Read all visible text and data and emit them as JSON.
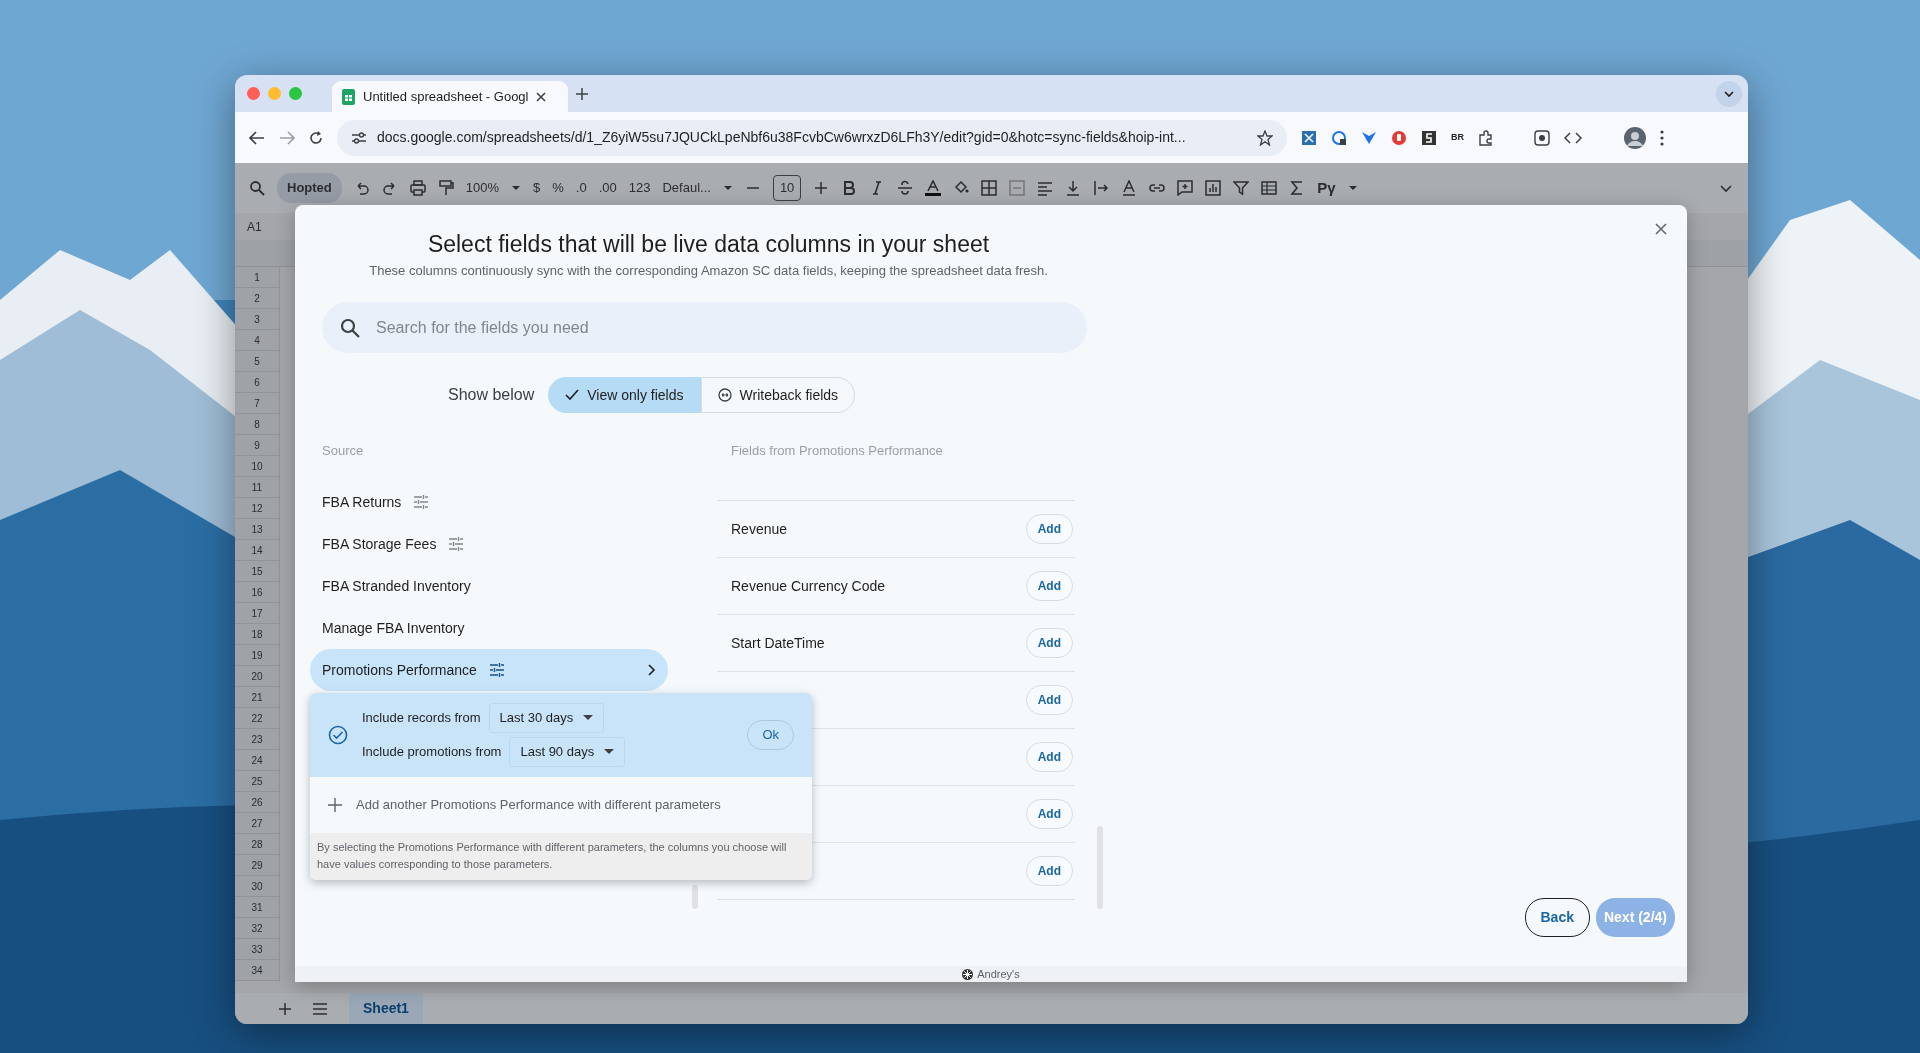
{
  "browser": {
    "tab_title": "Untitled spreadsheet - Googl",
    "url": "docs.google.com/spreadsheets/d/1_Z6yiW5su7JQUCkLpeNbf6u38FcvbCw6wrxzD6LFh3Y/edit?gid=0&hotc=sync-fields&hoip-int...",
    "extension_label": "BR"
  },
  "sheet_toolbar": {
    "menu_label": "Hopted",
    "zoom": "100%",
    "currency": "$",
    "percent": "%",
    "decrease_decimals": ".0",
    "increase_decimals": ".00",
    "number_format": "123",
    "font": "Defaul...",
    "font_size": "10",
    "extension": "Pγ"
  },
  "sheet": {
    "name_box": "A1",
    "row_numbers": [
      "1",
      "2",
      "3",
      "4",
      "5",
      "6",
      "7",
      "8",
      "9",
      "10",
      "11",
      "12",
      "13",
      "14",
      "15",
      "16",
      "17",
      "18",
      "19",
      "20",
      "21",
      "22",
      "23",
      "24",
      "25",
      "26",
      "27",
      "28",
      "29",
      "30",
      "31",
      "32",
      "33",
      "34"
    ],
    "sheet_tab": "Sheet1"
  },
  "dialog": {
    "title": "Select fields that will be live data columns in your sheet",
    "subtitle": "These columns continuously sync with the corresponding Amazon SC data fields, keeping the spreadsheet data fresh.",
    "search": {
      "placeholder": "Search for the fields you need"
    },
    "show_below_label": "Show below",
    "toggle": [
      {
        "label": "View only fields",
        "selected": true
      },
      {
        "label": "Writeback fields",
        "selected": false
      }
    ],
    "source_header": "Source",
    "sources": [
      {
        "name": "FBA Returns",
        "has_params": true,
        "selected": false
      },
      {
        "name": "FBA Storage Fees",
        "has_params": true,
        "selected": false
      },
      {
        "name": "FBA Stranded Inventory",
        "has_params": false,
        "selected": false
      },
      {
        "name": "Manage FBA Inventory",
        "has_params": false,
        "selected": false
      },
      {
        "name": "Promotions Performance",
        "has_params": true,
        "selected": true
      }
    ],
    "fields_header": "Fields from Promotions Performance",
    "fields": [
      {
        "name": "Revenue",
        "button": "Add"
      },
      {
        "name": "Revenue Currency Code",
        "button": "Add"
      },
      {
        "name": "Start DateTime",
        "button": "Add"
      },
      {
        "button": "Add"
      },
      {
        "button": "Add"
      },
      {
        "button": "Add"
      },
      {
        "button": "Add"
      }
    ],
    "params_popup": {
      "params": [
        {
          "label": "Include records from",
          "value": "Last 30 days"
        },
        {
          "label": "Include promotions from",
          "value": "Last 90 days"
        }
      ],
      "ok": "Ok",
      "add_another": "Add another Promotions Performance with different parameters",
      "note": "By selecting the Promotions Performance with different parameters, the columns you choose will have values corresponding to those parameters."
    },
    "back": "Back",
    "next": {
      "label": "Next (2/4)",
      "disabled": true
    },
    "footer": "Andrey's"
  }
}
